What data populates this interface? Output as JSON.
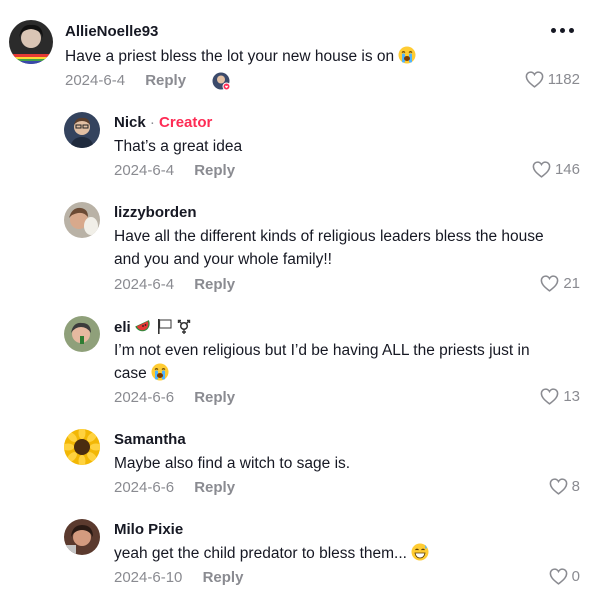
{
  "main_comment": {
    "author": "AllieNoelle93",
    "text": "Have a priest bless the lot your new house is on",
    "text_emoji": "loudly-crying-face",
    "date": "2024-6-4",
    "reply_label": "Reply",
    "likes": "1182",
    "more_icon": "more-options-icon"
  },
  "replies": [
    {
      "author": "Nick",
      "creator_label": "Creator",
      "separator": "·",
      "text": "That’s a great idea",
      "date": "2024-6-4",
      "reply_label": "Reply",
      "likes": "146"
    },
    {
      "author": "lizzyborden",
      "text_line1": "Have all the different kinds of religious leaders bless the house",
      "text_line2": "and you and your whole family!!",
      "date": "2024-6-4",
      "reply_label": "Reply",
      "likes": "21"
    },
    {
      "author": "eli",
      "author_emojis": [
        "watermelon",
        "white-flag",
        "transgender-symbol"
      ],
      "text_line1": "I’m not even religious but I’d be having ALL the priests just in",
      "text_line2": "case",
      "text_emoji": "loudly-crying-face",
      "date": "2024-6-6",
      "reply_label": "Reply",
      "likes": "13"
    },
    {
      "author": "Samantha",
      "text": "Maybe also find a witch to sage is.",
      "date": "2024-6-6",
      "reply_label": "Reply",
      "likes": "8"
    },
    {
      "author": "Milo Pixie",
      "text": "yeah get the child predator to bless them...",
      "text_emoji": "grinning-sweat-face",
      "date": "2024-6-10",
      "reply_label": "Reply",
      "likes": "0"
    }
  ],
  "colors": {
    "text": "#161823",
    "muted": "#8a8b91",
    "creator": "#fe2c55"
  }
}
